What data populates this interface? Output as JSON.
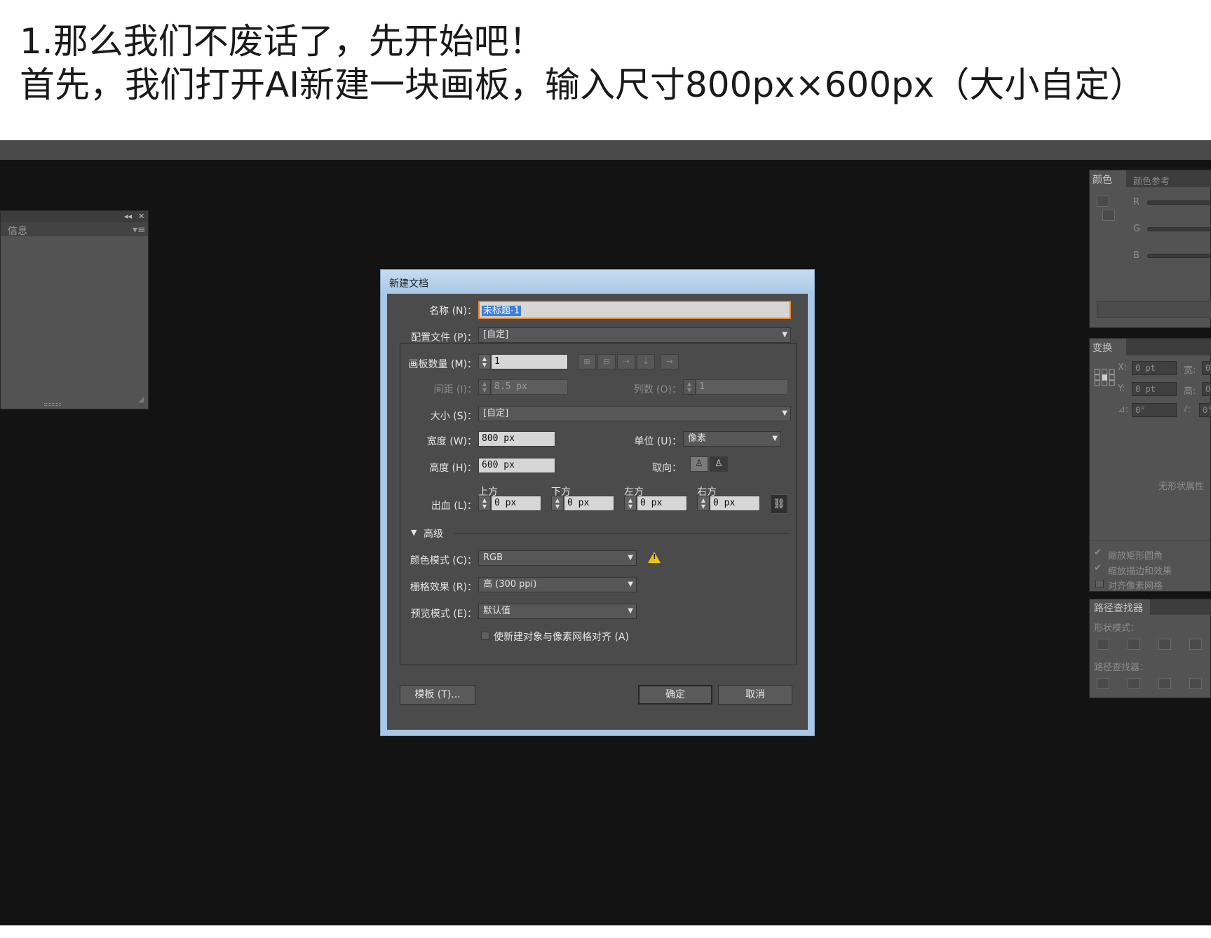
{
  "caption": {
    "line1": "1.那么我们不废话了，先开始吧！",
    "line2": "首先，我们打开AI新建一块画板，输入尺寸800px×600px（大小自定）"
  },
  "left_panel": {
    "tab": "信息",
    "collapse_icon": "double-chevron-left-icon",
    "close_icon": "close-icon",
    "menu_icon": "panel-menu-icon"
  },
  "color_panel": {
    "tab_active": "颜色",
    "tab_inactive": "颜色参考",
    "channels": [
      "R",
      "G",
      "B"
    ]
  },
  "transform_panel": {
    "tab": "变换",
    "x_label": "X:",
    "x_value": "0 pt",
    "y_label": "Y:",
    "y_value": "0 pt",
    "w_label": "宽:",
    "w_value": "0",
    "h_label": "高:",
    "h_value": "0",
    "angle_value": "0°",
    "shear_value": "0°",
    "no_shape_text": "无形状属性",
    "checkboxes": [
      {
        "label": "缩放矩形圆角",
        "checked": true
      },
      {
        "label": "缩放描边和效果",
        "checked": true
      },
      {
        "label": "对齐像素网格",
        "checked": false
      }
    ]
  },
  "pathfinder_panel": {
    "tab": "路径查找器",
    "shape_modes_label": "形状模式：",
    "pathfinders_label": "路径查找器："
  },
  "dialog": {
    "title": "新建文档",
    "name_label": "名称 (N)：",
    "name_value": "未标题-1",
    "profile_label": "配置文件 (P)：",
    "profile_value": "[自定]",
    "artboards_label": "画板数量 (M)：",
    "artboards_value": "1",
    "spacing_label": "间距 (I)：",
    "spacing_value": "8.5 px",
    "columns_label": "列数 (O)：",
    "columns_value": "1",
    "size_label": "大小 (S)：",
    "size_value": "[自定]",
    "width_label": "宽度 (W)：",
    "width_value": "800 px",
    "units_label": "单位 (U)：",
    "units_value": "像素",
    "height_label": "高度 (H)：",
    "height_value": "600 px",
    "orientation_label": "取向：",
    "bleed_label": "出血 (L)：",
    "bleed_top_label": "上方",
    "bleed_bottom_label": "下方",
    "bleed_left_label": "左方",
    "bleed_right_label": "右方",
    "bleed_top_value": "0 px",
    "bleed_bottom_value": "0 px",
    "bleed_left_value": "0 px",
    "bleed_right_value": "0 px",
    "advanced_label": "高级",
    "color_mode_label": "颜色模式 (C)：",
    "color_mode_value": "RGB",
    "raster_label": "栅格效果 (R)：",
    "raster_value": "高 (300 ppi)",
    "preview_label": "预览模式 (E)：",
    "preview_value": "默认值",
    "align_pixel_label": "使新建对象与像素网格对齐 (A)",
    "align_pixel_checked": false,
    "templates_button": "模板 (T)...",
    "ok_button": "确定",
    "cancel_button": "取消",
    "warning_glyph": "!"
  },
  "colors": {
    "workspace": "#131313",
    "panel": "#535353",
    "dialog_body": "#4b4b4b",
    "dialog_frame": "#a9c8e6",
    "name_highlight": "#3d7fd6"
  }
}
